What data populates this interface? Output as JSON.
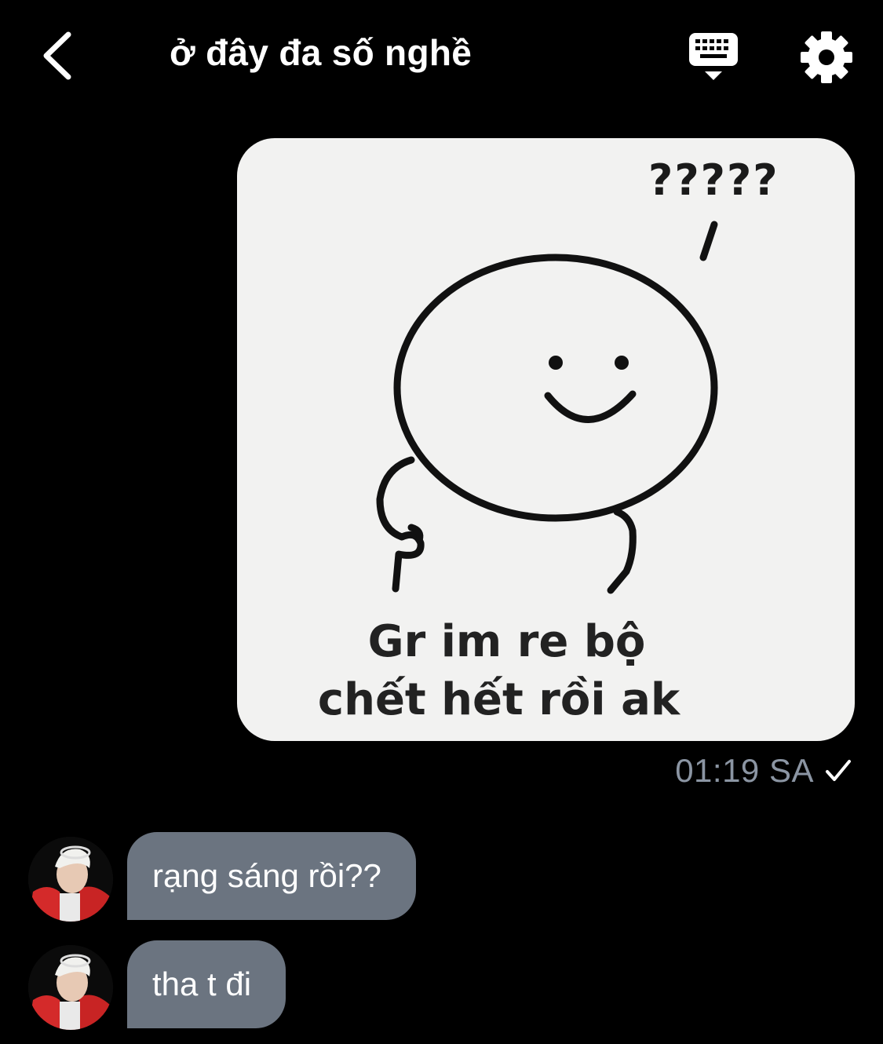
{
  "header": {
    "title": "ở đây đa số nghề"
  },
  "sticker": {
    "question_marks": "?????",
    "caption_line1": "Gr im re bộ",
    "caption_line2": "chết hết rồi ak"
  },
  "outgoing_meta": {
    "time": "01:19 SA",
    "status_icon": "check-icon"
  },
  "messages": [
    {
      "text": "rạng sáng rồi??"
    },
    {
      "text": "tha t đi"
    }
  ],
  "colors": {
    "background": "#000000",
    "bubble_incoming": "#6b7480",
    "timestamp": "#8b95a3",
    "sticker_bg": "#f2f2f1"
  }
}
